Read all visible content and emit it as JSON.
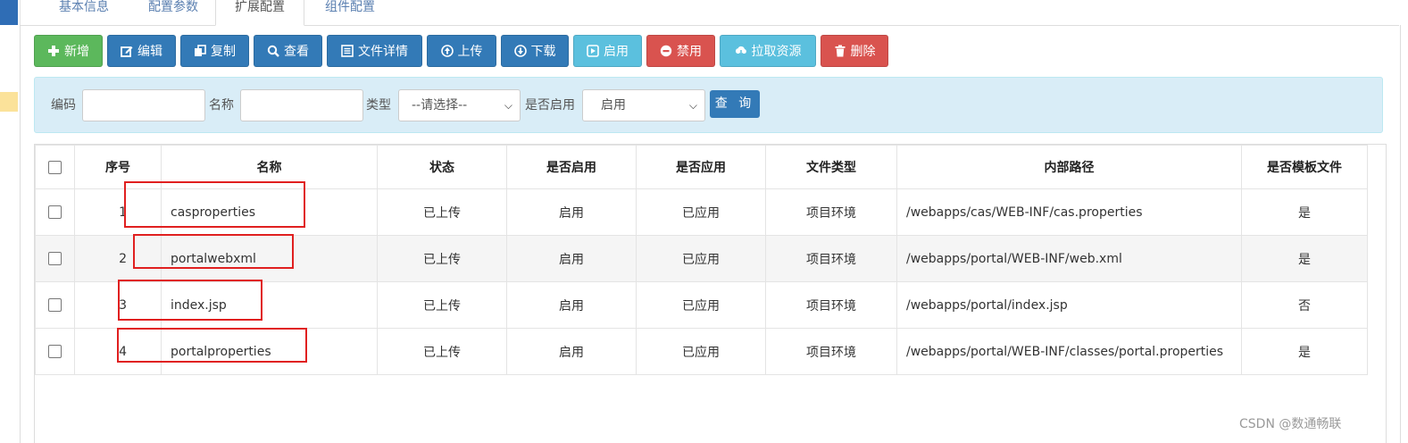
{
  "tabs": [
    {
      "label": "基本信息",
      "active": false
    },
    {
      "label": "配置参数",
      "active": false
    },
    {
      "label": "扩展配置",
      "active": true
    },
    {
      "label": "组件配置",
      "active": false
    }
  ],
  "toolbar": {
    "buttons": [
      {
        "label": "新增",
        "icon": "plus-icon",
        "color": "#5cb85c"
      },
      {
        "label": "编辑",
        "icon": "edit-icon",
        "color": "#337ab7"
      },
      {
        "label": "复制",
        "icon": "copy-icon",
        "color": "#337ab7"
      },
      {
        "label": "查看",
        "icon": "search-icon",
        "color": "#337ab7"
      },
      {
        "label": "文件详情",
        "icon": "list-icon",
        "color": "#337ab7"
      },
      {
        "label": "上传",
        "icon": "upload-icon",
        "color": "#337ab7"
      },
      {
        "label": "下载",
        "icon": "download-icon",
        "color": "#337ab7"
      },
      {
        "label": "启用",
        "icon": "play-icon",
        "color": "#5bc0de"
      },
      {
        "label": "禁用",
        "icon": "minus-circle-icon",
        "color": "#d9534f"
      },
      {
        "label": "拉取资源",
        "icon": "cloud-download-icon",
        "color": "#5bc0de"
      },
      {
        "label": "删除",
        "icon": "trash-icon",
        "color": "#d9534f"
      }
    ]
  },
  "search": {
    "code_label": "编码",
    "code_value": "",
    "name_label": "名称",
    "name_value": "",
    "type_label": "类型",
    "type_value": "--请选择--",
    "enabled_label": "是否启用",
    "enabled_value": "启用",
    "query_label": "查 询"
  },
  "table": {
    "headers": [
      "序号",
      "名称",
      "状态",
      "是否启用",
      "是否应用",
      "文件类型",
      "内部路径",
      "是否模板文件"
    ],
    "rows": [
      {
        "index": "1",
        "name": "casproperties",
        "status": "已上传",
        "enabled": "启用",
        "applied": "已应用",
        "file_type": "项目环境",
        "path": "/webapps/cas/WEB-INF/cas.properties",
        "is_template": "是"
      },
      {
        "index": "2",
        "name": "portalwebxml",
        "status": "已上传",
        "enabled": "启用",
        "applied": "已应用",
        "file_type": "项目环境",
        "path": "/webapps/portal/WEB-INF/web.xml",
        "is_template": "是"
      },
      {
        "index": "3",
        "name": "index.jsp",
        "status": "已上传",
        "enabled": "启用",
        "applied": "已应用",
        "file_type": "项目环境",
        "path": "/webapps/portal/index.jsp",
        "is_template": "否"
      },
      {
        "index": "4",
        "name": "portalproperties",
        "status": "已上传",
        "enabled": "启用",
        "applied": "已应用",
        "file_type": "项目环境",
        "path": "/webapps/portal/WEB-INF/classes/portal.properties",
        "is_template": "是"
      }
    ]
  },
  "annotation_color": "#e02020",
  "watermark": "CSDN @数通畅联"
}
